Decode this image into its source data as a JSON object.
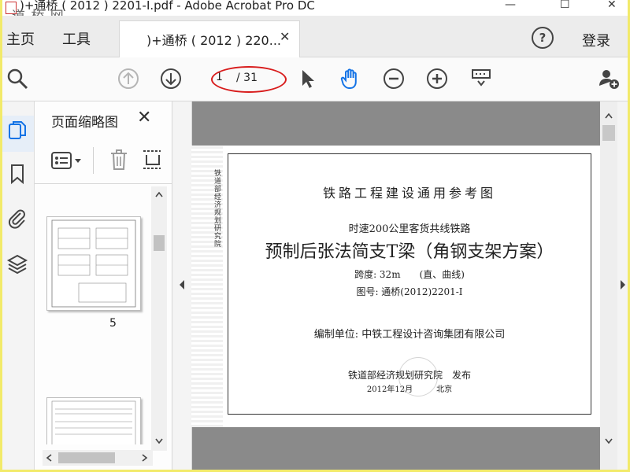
{
  "window": {
    "title": ")+通桥 ( 2012 ) 2201-I.pdf - Adobe Acrobat Pro DC",
    "watermark": "道 桥 网",
    "minimize": "—",
    "maximize": "☐",
    "close": "✕"
  },
  "menubar": {
    "home": "主页",
    "tools": "工具",
    "tab_title": ")+通桥 ( 2012 ) 220...",
    "tab_close": "✕",
    "help": "?",
    "login": "登录"
  },
  "toolbar": {
    "current_page": "1",
    "total_pages": "/ 31",
    "icons": [
      "search-icon",
      "page-up-icon",
      "page-down-icon",
      "select-arrow-icon",
      "hand-icon",
      "zoom-out-icon",
      "zoom-in-icon",
      "scroll-mode-icon",
      "share-user-icon"
    ]
  },
  "left_rail": {
    "icons": [
      "pages-icon",
      "bookmark-icon",
      "attachment-icon",
      "layers-icon"
    ]
  },
  "panel": {
    "title": "页面缩略图",
    "close": "✕",
    "thumb_labels": [
      "5"
    ]
  },
  "page": {
    "header": "铁路工程建设通用参考图",
    "subtitle": "时速200公里客货共线铁路",
    "title": "预制后张法简支T梁（角钢支架方案）",
    "span": "跨度: 32m　　(直、曲线)",
    "drawing_no": "图号: 通桥(2012)2201-Ⅰ",
    "editor": "编制单位: 中铁工程设计咨询集团有限公司",
    "publisher": "铁道部经济规划研究院　发布",
    "date": "2012年12月　　　北京",
    "spine_text": "铁道部经济规划研究院"
  },
  "colors": {
    "frame": "#f2ea6a",
    "accent": "#1473e6",
    "annotation_red": "#d81c1c",
    "doc_bg": "#8a8a8a"
  }
}
